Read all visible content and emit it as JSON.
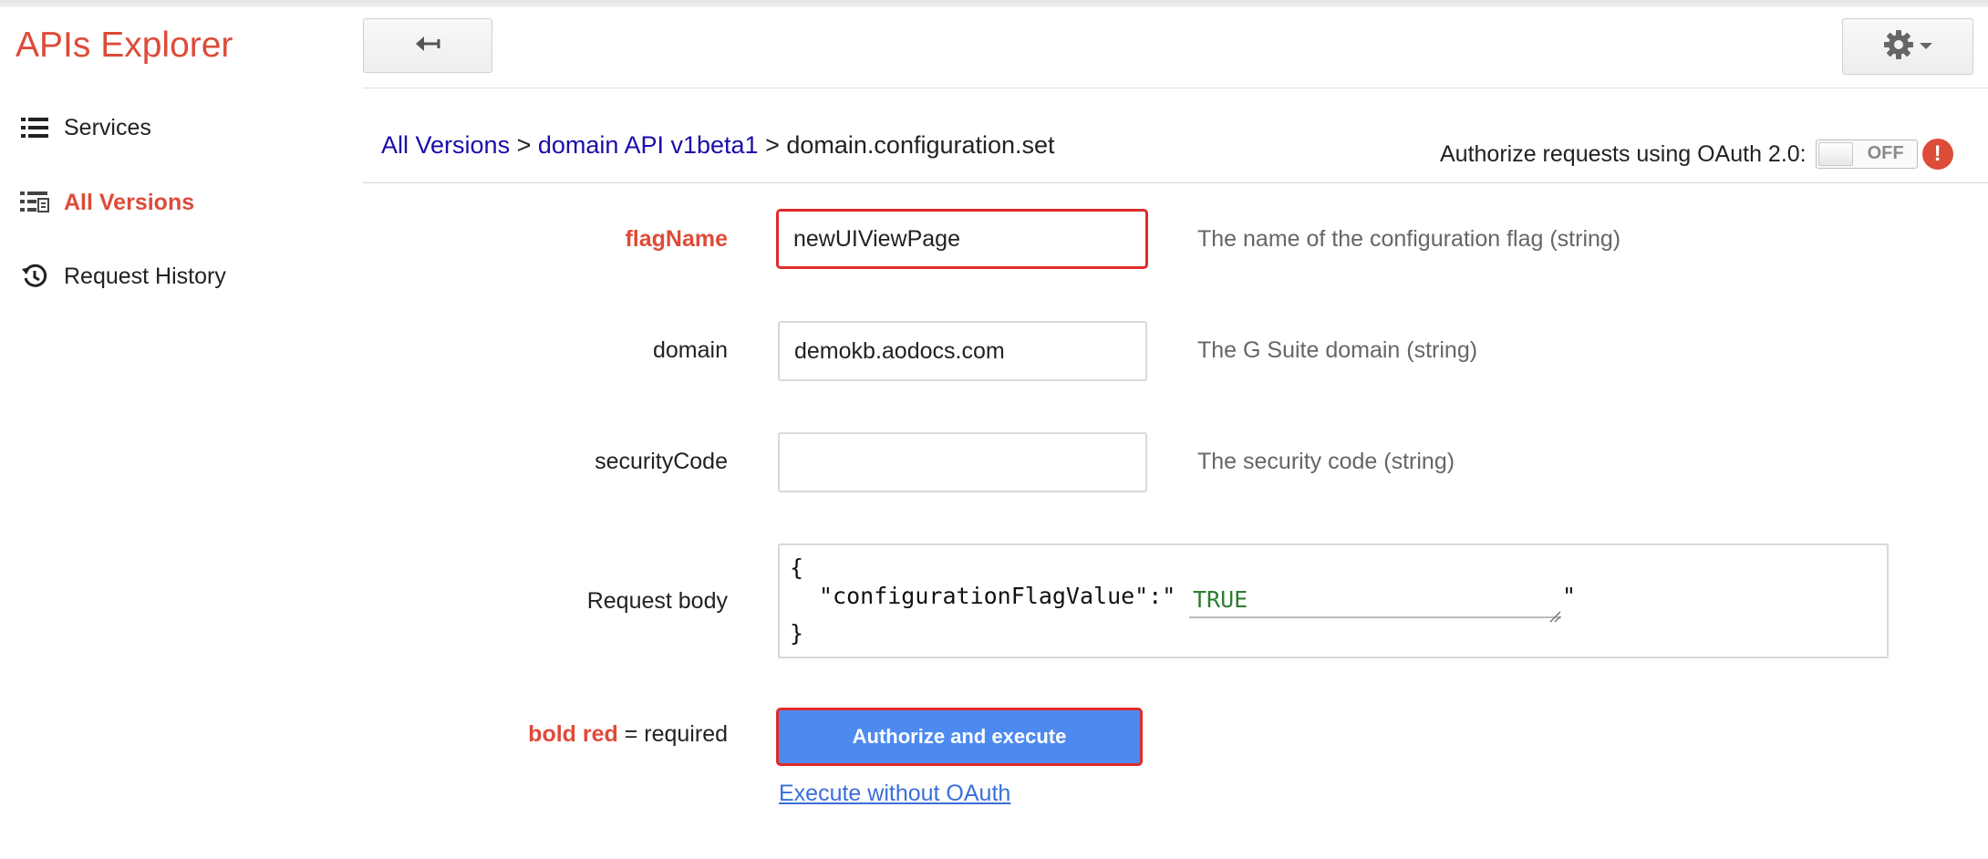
{
  "app": {
    "title": "APIs Explorer"
  },
  "sidebar": {
    "items": [
      {
        "label": "Services",
        "icon": "list-icon",
        "active": false
      },
      {
        "label": "All Versions",
        "icon": "versions-grid-icon",
        "active": true
      },
      {
        "label": "Request History",
        "icon": "history-icon",
        "active": false
      }
    ]
  },
  "header": {
    "back_icon": "back-arrow-icon",
    "settings_icon": "gear-icon"
  },
  "breadcrumb": {
    "items": [
      "All Versions",
      "domain API v1beta1"
    ],
    "separator": ">",
    "current": "domain.configuration.set"
  },
  "oauth": {
    "label": "Authorize requests using OAuth 2.0:",
    "toggle_state": "OFF",
    "warning_icon": "!"
  },
  "form": {
    "fields": [
      {
        "label": "flagName",
        "value": "newUIViewPage",
        "description": "The name of the configuration flag (string)",
        "required": true
      },
      {
        "label": "domain",
        "value": "demokb.aodocs.com",
        "description": "The G Suite domain (string)",
        "required": false
      },
      {
        "label": "securityCode",
        "value": "",
        "description": "The security code (string)",
        "required": false
      }
    ],
    "request_body": {
      "label": "Request body",
      "open_brace": "{",
      "key_text": "\"configurationFlagValue\":\"",
      "value": "TRUE",
      "closing_quote": "\"",
      "close_brace": "}"
    },
    "required_note": {
      "emphasis": "bold red",
      "rest": " = required"
    },
    "execute_button": "Authorize and execute",
    "execute_link": "Execute without OAuth"
  },
  "colors": {
    "accent_red": "#dd4b39",
    "link_blue": "#1a0dab",
    "button_blue": "#4d8af0",
    "highlight_border": "#e02a2a",
    "value_green": "#2e7d32"
  }
}
